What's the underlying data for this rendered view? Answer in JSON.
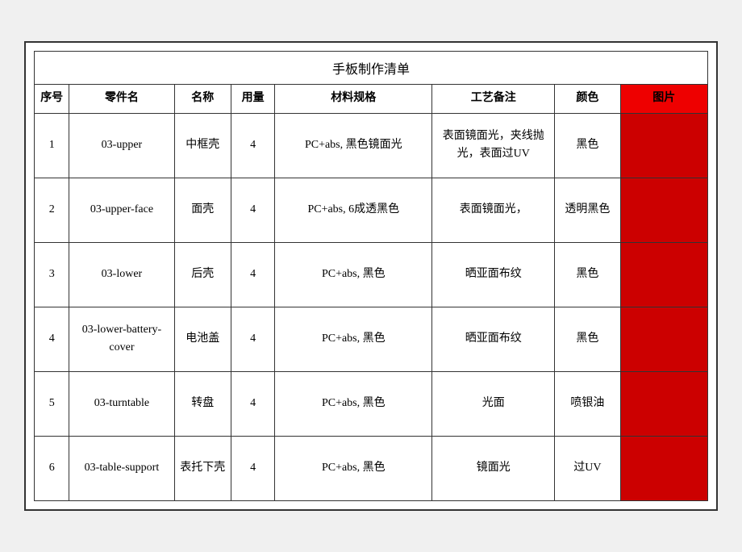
{
  "title": "手板制作清单",
  "headers": {
    "seq": "序号",
    "part": "零件名",
    "name": "名称",
    "qty": "用量",
    "spec": "材料规格",
    "process": "工艺备注",
    "color": "颜色",
    "img": "图片"
  },
  "rows": [
    {
      "seq": "1",
      "part": "03-upper",
      "name": "中框壳",
      "qty": "4",
      "spec": "PC+abs, 黑色镜面光",
      "process": "表面镜面光，夹线抛光，表面过UV",
      "color": "黑色"
    },
    {
      "seq": "2",
      "part": "03-upper-face",
      "name": "面壳",
      "qty": "4",
      "spec": "PC+abs, 6成透黑色",
      "process": "表面镜面光，",
      "color": "透明黑色"
    },
    {
      "seq": "3",
      "part": "03-lower",
      "name": "后壳",
      "qty": "4",
      "spec": "PC+abs, 黑色",
      "process": "晒亚面布纹",
      "color": "黑色"
    },
    {
      "seq": "4",
      "part": "03-lower-battery-cover",
      "name": "电池盖",
      "qty": "4",
      "spec": "PC+abs, 黑色",
      "process": "晒亚面布纹",
      "color": "黑色"
    },
    {
      "seq": "5",
      "part": "03-turntable",
      "name": "转盘",
      "qty": "4",
      "spec": "PC+abs, 黑色",
      "process": "光面",
      "color": "喷银油"
    },
    {
      "seq": "6",
      "part": "03-table-support",
      "name": "表托下壳",
      "qty": "4",
      "spec": "PC+abs, 黑色",
      "process": "镜面光",
      "color": "过UV"
    }
  ]
}
